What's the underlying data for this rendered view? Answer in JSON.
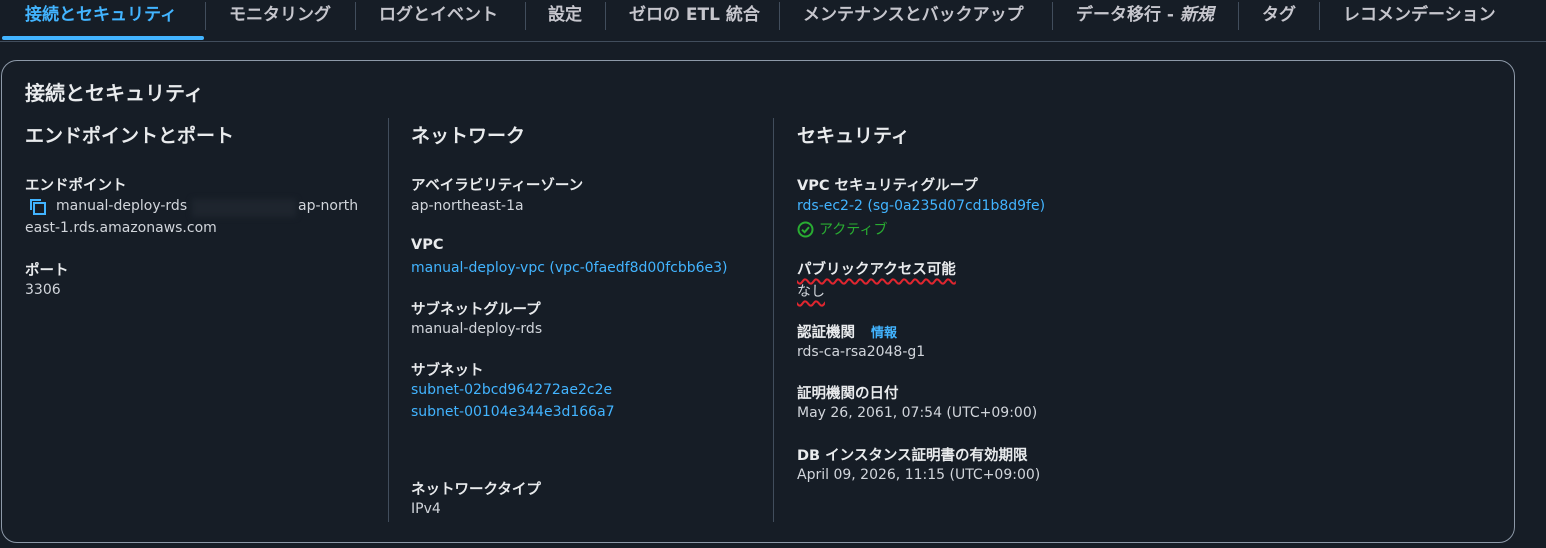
{
  "tabs": [
    {
      "label": "接続とセキュリティ",
      "active": true
    },
    {
      "label": "モニタリング"
    },
    {
      "label": "ログとイベント"
    },
    {
      "label": "設定"
    },
    {
      "label": "ゼロの ETL 統合"
    },
    {
      "label": "メンテナンスとバックアップ"
    },
    {
      "label": "データ移行 - ",
      "badge": "新規"
    },
    {
      "label": "タグ"
    },
    {
      "label": "レコメンデーション"
    }
  ],
  "panel": {
    "title": "接続とセキュリティ",
    "endpoint_section": {
      "title": "エンドポイントとポート",
      "endpoint_label": "エンドポイント",
      "endpoint_value_start": "manual-deploy-rds",
      "endpoint_value_mid": "ap-north",
      "endpoint_value_end": "east-1.rds.amazonaws.com",
      "port_label": "ポート",
      "port_value": "3306"
    },
    "network_section": {
      "title": "ネットワーク",
      "az_label": "アベイラビリティーゾーン",
      "az_value": "ap-northeast-1a",
      "vpc_label": "VPC",
      "vpc_value": "manual-deploy-vpc (vpc-0faedf8d00fcbb6e3)",
      "subnet_group_label": "サブネットグループ",
      "subnet_group_value": "manual-deploy-rds",
      "subnets_label": "サブネット",
      "subnets": [
        "subnet-02bcd964272ae2c2e",
        "subnet-00104e344e3d166a7"
      ],
      "network_type_label": "ネットワークタイプ",
      "network_type_value": "IPv4"
    },
    "security_section": {
      "title": "セキュリティ",
      "sg_label": "VPC セキュリティグループ",
      "sg_value": "rds-ec2-2 (sg-0a235d07cd1b8d9fe)",
      "sg_status": "アクティブ",
      "public_access_label": "パブリックアクセス可能",
      "public_access_value": "なし",
      "ca_label": "認証機関",
      "ca_info": "情報",
      "ca_value": "rds-ca-rsa2048-g1",
      "ca_date_label": "証明機関の日付",
      "ca_date_value": "May 26, 2061, 07:54 (UTC+09:00)",
      "db_cert_label": "DB インスタンス証明書の有効期限",
      "db_cert_value": "April 09, 2026, 11:15 (UTC+09:00)"
    }
  },
  "colors": {
    "link": "#42b4ff",
    "status_ok": "#29ad32",
    "underline_mark": "#e0262f"
  }
}
